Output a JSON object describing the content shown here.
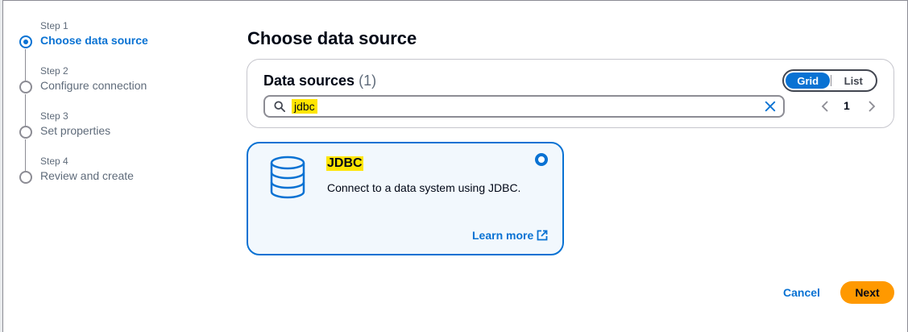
{
  "wizard": {
    "steps": [
      {
        "number": "Step 1",
        "title": "Choose data source",
        "active": true
      },
      {
        "number": "Step 2",
        "title": "Configure connection",
        "active": false
      },
      {
        "number": "Step 3",
        "title": "Set properties",
        "active": false
      },
      {
        "number": "Step 4",
        "title": "Review and create",
        "active": false
      }
    ]
  },
  "main": {
    "page_title": "Choose data source",
    "data_sources": {
      "header": "Data sources",
      "count": "(1)",
      "view_toggle": {
        "grid_label": "Grid",
        "list_label": "List",
        "selected": "Grid"
      },
      "search": {
        "value": "jdbc"
      },
      "pagination": {
        "current_page": "1"
      }
    },
    "cards": [
      {
        "title": "JDBC",
        "description": "Connect to a data system using JDBC.",
        "icon": "database-icon",
        "selected": true,
        "learn_more_label": "Learn more"
      }
    ]
  },
  "footer": {
    "cancel_label": "Cancel",
    "next_label": "Next"
  },
  "colors": {
    "accent": "#0972d3",
    "primary_button": "#ff9900",
    "highlight": "#ffe500",
    "card_selected_bg": "#f2f8fd"
  }
}
